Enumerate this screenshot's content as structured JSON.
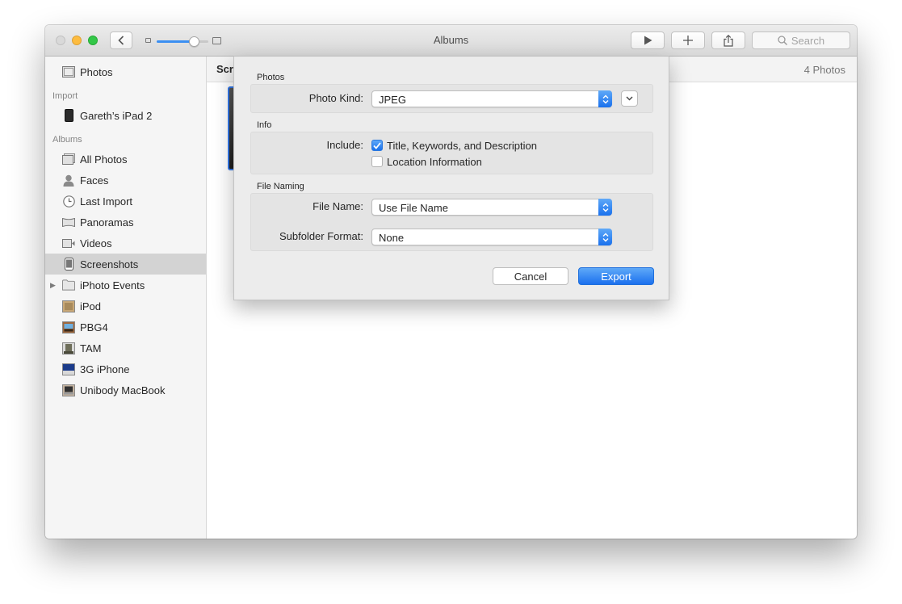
{
  "window": {
    "title": "Albums",
    "search_placeholder": "Search"
  },
  "sidebar": {
    "top_item": {
      "label": "Photos",
      "icon": "photos-icon"
    },
    "import_section": "Import",
    "import_items": [
      {
        "label": "Gareth’s iPad 2",
        "icon": "ipad-icon"
      }
    ],
    "albums_section": "Albums",
    "albums": [
      {
        "label": "All Photos",
        "icon": "all-photos-icon"
      },
      {
        "label": "Faces",
        "icon": "faces-icon"
      },
      {
        "label": "Last Import",
        "icon": "clock-icon"
      },
      {
        "label": "Panoramas",
        "icon": "panorama-icon"
      },
      {
        "label": "Videos",
        "icon": "video-icon"
      },
      {
        "label": "Screenshots",
        "icon": "screenshot-icon",
        "selected": true
      },
      {
        "label": "iPhoto Events",
        "icon": "folder-icon"
      },
      {
        "label": "iPod",
        "icon": "album-thumb-icon"
      },
      {
        "label": "PBG4",
        "icon": "album-thumb-icon"
      },
      {
        "label": "TAM",
        "icon": "album-thumb-icon"
      },
      {
        "label": "3G iPhone",
        "icon": "album-thumb-icon"
      },
      {
        "label": "Unibody MacBook",
        "icon": "album-thumb-icon"
      }
    ]
  },
  "content": {
    "album_name": "Screenshots",
    "photo_count": "4 Photos"
  },
  "export_sheet": {
    "photos_group": "Photos",
    "photo_kind_label": "Photo Kind:",
    "photo_kind_value": "JPEG",
    "info_group": "Info",
    "include_label": "Include:",
    "include_title": "Title, Keywords, and Description",
    "include_title_checked": true,
    "include_location": "Location Information",
    "include_location_checked": false,
    "file_naming_group": "File Naming",
    "file_name_label": "File Name:",
    "file_name_value": "Use File Name",
    "subfolder_label": "Subfolder Format:",
    "subfolder_value": "None",
    "cancel_label": "Cancel",
    "export_label": "Export"
  },
  "colors": {
    "accent": "#1a71ed",
    "selection": "#d3d3d3",
    "close": "#d9d9d9",
    "minimize": "#fdbc40",
    "maximize": "#33c748"
  }
}
